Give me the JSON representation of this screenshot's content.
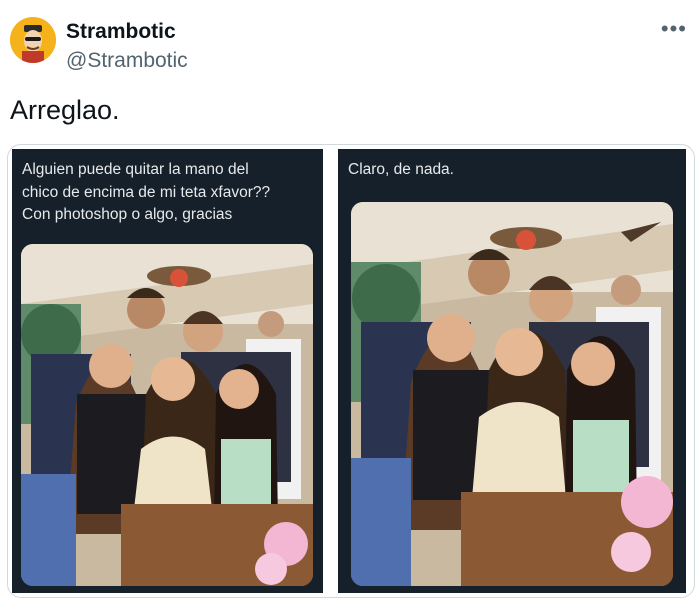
{
  "tweet": {
    "display_name": "Strambotic",
    "handle": "@Strambotic",
    "text": "Arreglao.",
    "more_icon": "more-options-icon"
  },
  "media": {
    "left_panel": {
      "caption": "Alguien puede quitar la mano del\nchico de encima de mi teta xfavor??\nCon photoshop o algo, gracias"
    },
    "right_panel": {
      "caption": "Claro, de nada."
    }
  },
  "colors": {
    "dark_panel": "#15202b",
    "avatar_bg": "#f5b21b",
    "handle_gray": "#536471"
  }
}
